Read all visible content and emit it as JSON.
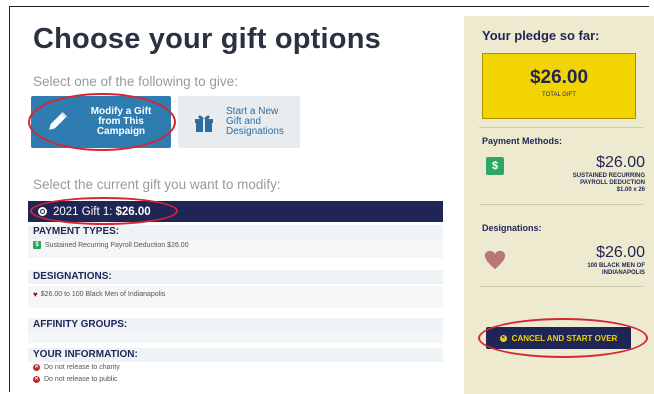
{
  "header": {
    "title": "Choose your gift options"
  },
  "choose": {
    "label": "Select one of the following to give:",
    "options": [
      {
        "label_line1": "Modify a Gift",
        "label_line2": "from This",
        "label_line3": "Campaign",
        "icon": "pencil-icon"
      },
      {
        "label_line1": "Start a New",
        "label_line2": "Gift and",
        "label_line3": "Designations",
        "icon": "gift-icon"
      }
    ]
  },
  "modify": {
    "label": "Select the current gift you want to modify:",
    "gift_title": "2021 Gift 1:",
    "gift_amount": "$26.00"
  },
  "sections": {
    "payment_types": {
      "heading": "PAYMENT TYPES:",
      "line": "Sustained Recurring Payroll Deduction $26.00"
    },
    "designations": {
      "heading": "DESIGNATIONS:",
      "line": "$26.00 to 100 Black Men of Indianapolis"
    },
    "affinity": {
      "heading": "AFFINITY GROUPS:"
    },
    "your_info": {
      "heading": "YOUR INFORMATION:",
      "lines": [
        "Do not release to charity",
        "Do not release to public"
      ]
    }
  },
  "pledge": {
    "title": "Your pledge so far:",
    "total_amount": "$26.00",
    "total_label": "TOTAL GIFT",
    "payment_methods_heading": "Payment Methods:",
    "payment_amount": "$26.00",
    "payment_sub1": "SUSTAINED RECURRING",
    "payment_sub2": "PAYROLL DEDUCTION",
    "payment_sub3": "$1.00 x 26",
    "designations_heading": "Designations:",
    "designation_amount": "$26.00",
    "designation_sub1": "100 BLACK MEN OF",
    "designation_sub2": "INDIANAPOLIS",
    "cancel_label": "CANCEL AND START OVER"
  },
  "colors": {
    "navy": "#1f2554",
    "yellow": "#f2d500",
    "blue": "#2e7cb0",
    "green": "#2ea862",
    "annotation_red": "#d7262e"
  }
}
